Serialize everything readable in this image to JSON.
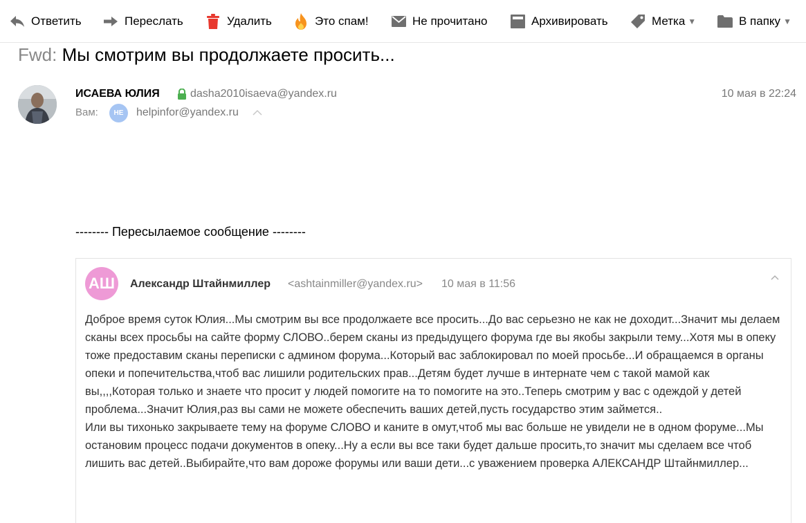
{
  "toolbar": {
    "reply": "Ответить",
    "forward": "Переслать",
    "delete": "Удалить",
    "spam": "Это спам!",
    "unread": "Не прочитано",
    "archive": "Архивировать",
    "label": "Метка",
    "folder": "В папку"
  },
  "message": {
    "subject_prefix": "Fwd:",
    "subject": "Мы смотрим вы продолжаете просить...",
    "sender_name": "ИСАЕВА ЮЛИЯ",
    "sender_email": "dasha2010isaeva@yandex.ru",
    "date": "10 мая в 22:24",
    "to_label": "Вам:",
    "to_initials": "HE",
    "to_email": "helpinfor@yandex.ru",
    "forward_header": "-------- Пересылаемое сообщение --------"
  },
  "quoted": {
    "initials": "АШ",
    "sender_name": "Александр Штайнмиллер",
    "sender_email": "<ashtainmiller@yandex.ru>",
    "date": "10 мая в 11:56",
    "paragraph_1": " Доброе время суток Юлия...Мы смотрим вы все продолжаете все просить...До вас серьезно не как не доходит...Значит мы делаем сканы всех просьбы на сайте форму СЛОВО..берем сканы из предыдущего форума где вы якобы закрыли тему...Хотя мы в опеку тоже предоставим сканы переписки с админом форума...Который вас заблокировал по моей просьбе...И обращаемся в органы опеки и попечительства,чтоб вас лишили родительских прав...Детям будет лучше в интернате чем с такой мамой как вы,,,,Которая только и знаете что просит у людей помогите на то помогите на это..Теперь смотрим у вас с одеждой у детей проблема...Значит Юлия,раз вы сами не можете обеспечить ваших детей,пусть государство этим займется..",
    "paragraph_2": " Или вы тихонько закрываете тему на форуме СЛОВО и каните в омут,чтоб мы вас больше не увидели не в одном форуме...Мы остановим процесс подачи документов в опеку...Ну а если вы все таки будет дальше просить,то значит мы сделаем все чтоб лишить вас детей..Выбирайте,что вам дороже форумы или ваши дети...с уважением проверка АЛЕКСАНДР Штайнмиллер..."
  },
  "colors": {
    "delete_icon": "#e8382e",
    "spam_icon": "#f7931e",
    "lock_icon": "#4caf50",
    "to_avatar": "#a6c5f3",
    "quoted_avatar": "#ee9ad6"
  }
}
